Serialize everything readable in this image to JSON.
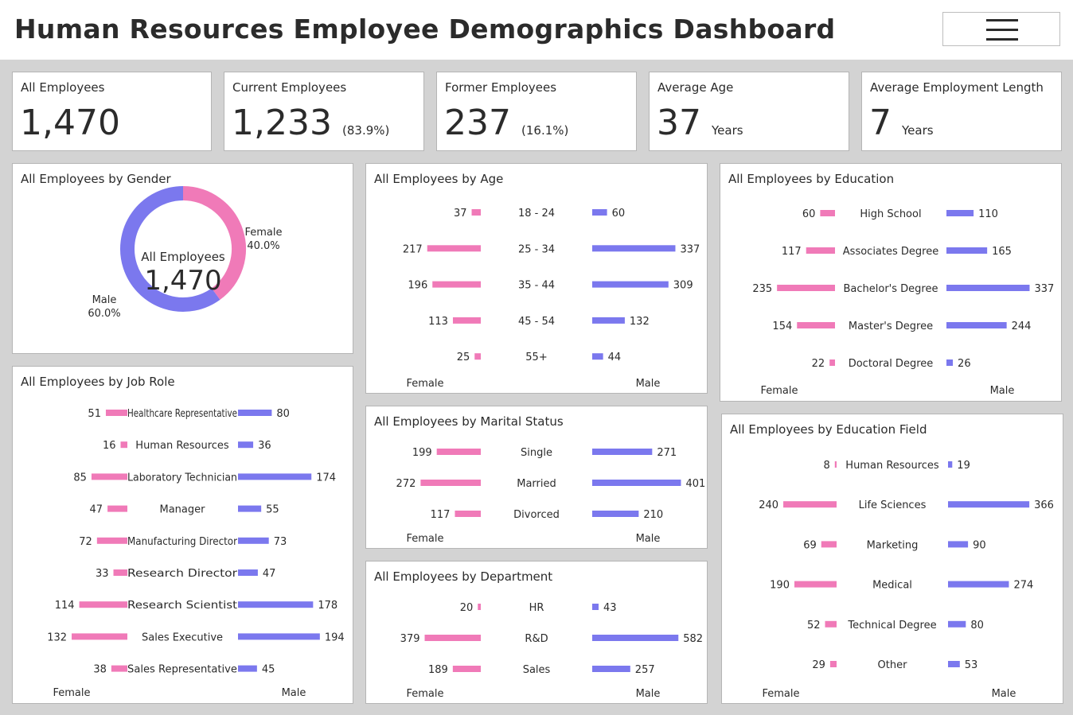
{
  "header": {
    "title": "Human Resources Employee Demographics Dashboard",
    "menu_icon": "hamburger-menu-icon"
  },
  "colors": {
    "female": "#f07ab8",
    "male": "#7b78ee",
    "text": "#2b2b2b",
    "panel_border": "#b5b5b5",
    "background": "#d3d3d3"
  },
  "kpis": {
    "all": {
      "label": "All Employees",
      "value": "1,470"
    },
    "current": {
      "label": "Current Employees",
      "value": "1,233",
      "sub": "(83.9%)"
    },
    "former": {
      "label": "Former Employees",
      "value": "237",
      "sub": "(16.1%)"
    },
    "age": {
      "label": "Average Age",
      "value": "37",
      "sub": "Years"
    },
    "length": {
      "label": "Average Employment Length",
      "value": "7",
      "sub": "Years"
    }
  },
  "gender": {
    "title": "All Employees by Gender",
    "center_label": "All Employees",
    "center_value": "1,470",
    "female_label": "Female",
    "female_pct": "40.0%",
    "male_label": "Male",
    "male_pct": "60.0%"
  },
  "chart_data": [
    {
      "type": "pie",
      "id": "gender",
      "title": "All Employees by Gender",
      "categories": [
        "Female",
        "Male"
      ],
      "values": [
        40.0,
        60.0
      ]
    },
    {
      "type": "bar",
      "id": "age",
      "title": "All Employees by Age",
      "categories": [
        "18 - 24",
        "25 - 34",
        "35 - 44",
        "45 - 54",
        "55+"
      ],
      "series": [
        {
          "name": "Female",
          "values": [
            37,
            217,
            196,
            113,
            25
          ]
        },
        {
          "name": "Male",
          "values": [
            60,
            337,
            309,
            132,
            44
          ]
        }
      ]
    },
    {
      "type": "bar",
      "id": "education",
      "title": "All Employees by Education",
      "categories": [
        "High School",
        "Associates Degree",
        "Bachelor's Degree",
        "Master's Degree",
        "Doctoral Degree"
      ],
      "series": [
        {
          "name": "Female",
          "values": [
            60,
            117,
            235,
            154,
            22
          ]
        },
        {
          "name": "Male",
          "values": [
            110,
            165,
            337,
            244,
            26
          ]
        }
      ]
    },
    {
      "type": "bar",
      "id": "jobrole",
      "title": "All Employees by Job Role",
      "categories": [
        "Healthcare Representative",
        "Human Resources",
        "Laboratory Technician",
        "Manager",
        "Manufacturing Director",
        "Research Director",
        "Research Scientist",
        "Sales Executive",
        "Sales Representative"
      ],
      "series": [
        {
          "name": "Female",
          "values": [
            51,
            16,
            85,
            47,
            72,
            33,
            114,
            132,
            38
          ]
        },
        {
          "name": "Male",
          "values": [
            80,
            36,
            174,
            55,
            73,
            47,
            178,
            194,
            45
          ]
        }
      ]
    },
    {
      "type": "bar",
      "id": "marital",
      "title": "All Employees by Marital Status",
      "categories": [
        "Single",
        "Married",
        "Divorced"
      ],
      "series": [
        {
          "name": "Female",
          "values": [
            199,
            272,
            117
          ]
        },
        {
          "name": "Male",
          "values": [
            271,
            401,
            210
          ]
        }
      ]
    },
    {
      "type": "bar",
      "id": "department",
      "title": "All Employees by Department",
      "categories": [
        "HR",
        "R&D",
        "Sales"
      ],
      "series": [
        {
          "name": "Female",
          "values": [
            20,
            379,
            189
          ]
        },
        {
          "name": "Male",
          "values": [
            43,
            582,
            257
          ]
        }
      ]
    },
    {
      "type": "bar",
      "id": "edufield",
      "title": "All Employees by Education Field",
      "categories": [
        "Human Resources",
        "Life Sciences",
        "Marketing",
        "Medical",
        "Technical Degree",
        "Other"
      ],
      "series": [
        {
          "name": "Female",
          "values": [
            8,
            240,
            69,
            190,
            52,
            29
          ]
        },
        {
          "name": "Male",
          "values": [
            19,
            366,
            90,
            274,
            80,
            53
          ]
        }
      ]
    }
  ]
}
